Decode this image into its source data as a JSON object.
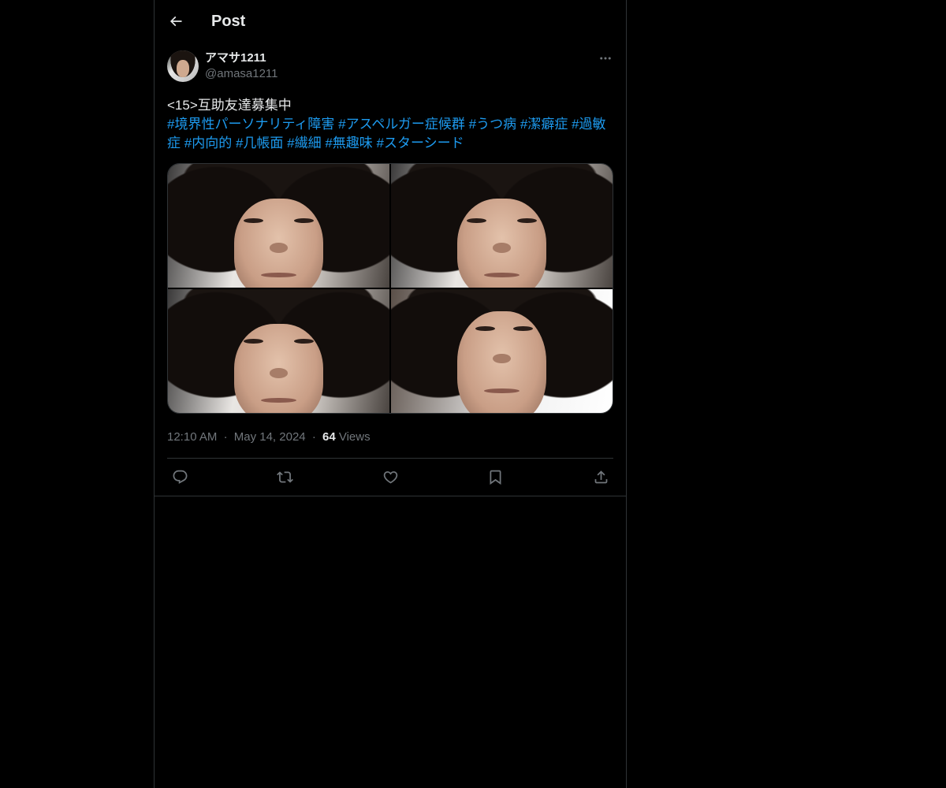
{
  "header": {
    "title": "Post",
    "back_icon": "arrow-left-icon"
  },
  "post": {
    "author": {
      "display_name": "アマサ1211",
      "handle": "@amasa1211"
    },
    "text_first": "<15>互助友達募集中",
    "hashtags": [
      "#境界性パーソナリティ障害",
      "#アスペルガー症候群",
      "#うつ病",
      "#潔癖症",
      "#過敏症",
      "#内向的",
      "#几帳面",
      "#繊細",
      "#無趣味",
      "#スターシード"
    ],
    "media_count": 4,
    "time": "12:10 AM",
    "separator": "·",
    "date": "May 14, 2024",
    "views_count": "64",
    "views_label": "Views"
  },
  "actions": {
    "icons": [
      "reply-icon",
      "repost-icon",
      "like-icon",
      "bookmark-icon",
      "share-icon"
    ]
  },
  "colors": {
    "background": "#000000",
    "text": "#e7e9ea",
    "secondary_text": "#71767b",
    "link": "#1d9bf0",
    "border": "#2f3336"
  }
}
